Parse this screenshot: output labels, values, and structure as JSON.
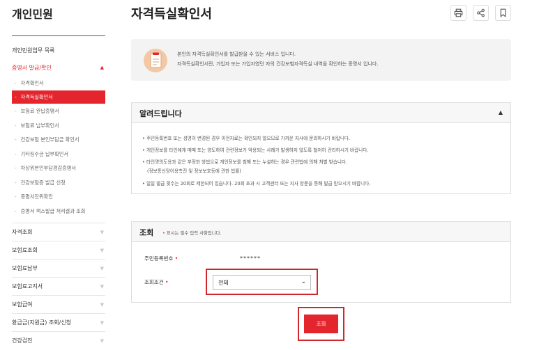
{
  "sidebar": {
    "title": "개인민원",
    "link_main": "개인민원업무 목록",
    "open_section": "증명서 발급/확인",
    "sub_items": [
      "자격확인서",
      "자격득실확인서",
      "보험료 완납증명서",
      "보험료 납부확인서",
      "건강보험 본인부담금 확인서",
      "기타징수금 납부확인서",
      "차상위본인부담경감증명서",
      "건강보험증 발급 신청",
      "증명서진위확인",
      "증명서 팩스발급 처리결과 조회"
    ],
    "active_index": 1,
    "categories": [
      "자격조회",
      "보험료조회",
      "보험료납부",
      "보험료고지서",
      "보험급여",
      "환급금(지원금) 조회/신청",
      "건강검진"
    ]
  },
  "header": {
    "title": "자격득실확인서",
    "icons": [
      "printer-icon",
      "share-icon",
      "bookmark-icon"
    ]
  },
  "intro": {
    "line1": "본인의 자격득실확인서를 발급받을 수 있는 서비스 입니다.",
    "line2": "자격득실확인서란, 가입자 또는 가입자였던 자의 건강보험자격득실 내역을 확인하는 증명서 입니다."
  },
  "notice": {
    "title": "알려드립니다",
    "items": [
      "• 주민등록번호 또는 성명이 변경된 경우 이전자료는 확인되지 않으므로 가까운 지사에 문의하시기 바랍니다.",
      "• 개인정보를 타인에게 매매 또는 양도하여 관련정보가 악용되는 사례가 발생하지 않도록 철저히 관리하시기 바랍니다.",
      "• 타인명의도용과 같은 부정한 방법으로 개인정보를 침해 또는 누설하는 경우 관련법에 의해 처벌 받습니다.",
      "(정보통신망이용촉진 및 정보보호등에 관한 법률)",
      "• 일일 발급 횟수는 20회로 제한되어 있습니다. 20회 초과 시 고객센터 또는 지사 방문을 통해 발급 받으시기 바랍니다."
    ]
  },
  "query": {
    "title": "조회",
    "required_note": "표시는 필수 입력 사항입니다.",
    "ssn_label": "주민등록번호",
    "ssn_value": "******",
    "condition_label": "조회조건",
    "condition_value": "전체",
    "submit_label": "조회"
  },
  "colors": {
    "accent": "#e4252e"
  }
}
